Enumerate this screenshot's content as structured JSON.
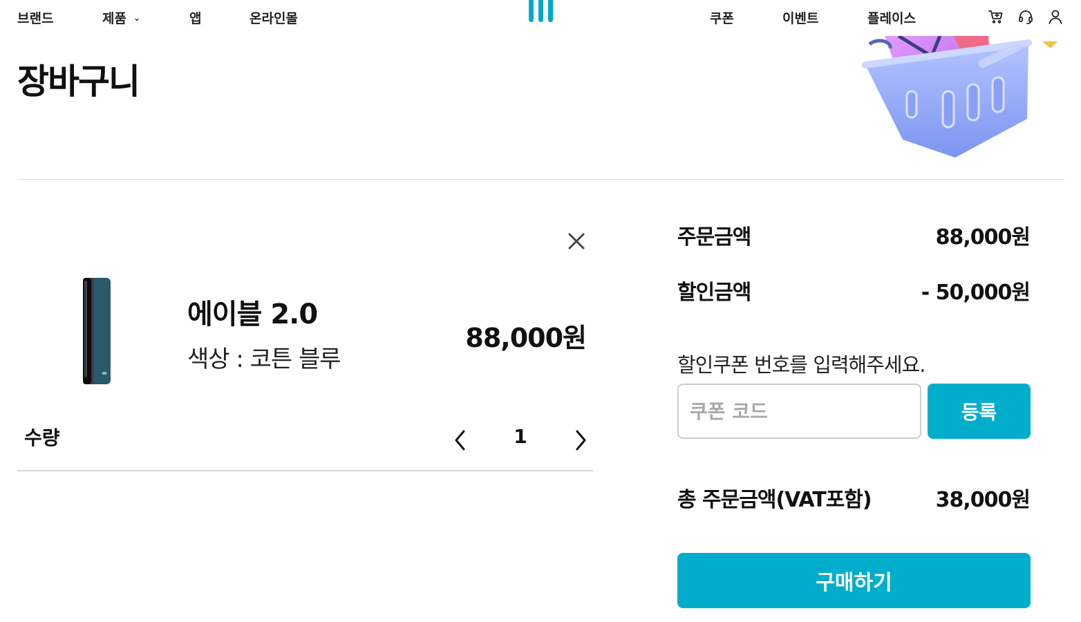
{
  "nav": {
    "left": [
      {
        "label": "브랜드"
      },
      {
        "label": "제품",
        "icon": "chevron-down-icon"
      },
      {
        "label": "앱"
      },
      {
        "label": "온라인몰"
      }
    ],
    "right": [
      {
        "label": "쿠폰"
      },
      {
        "label": "이벤트"
      },
      {
        "label": "플레이스"
      }
    ],
    "icons": [
      "cart-icon",
      "headset-icon",
      "user-icon"
    ],
    "logo_color": "#00a9c6"
  },
  "page": {
    "title": "장바구니"
  },
  "cart": {
    "items": [
      {
        "name": "에이블 2.0",
        "option": "색상 : 코튼 블루",
        "price": "88,000원",
        "quantity_label": "수량",
        "quantity": "1"
      }
    ]
  },
  "summary": {
    "order_amount_label": "주문금액",
    "order_amount": "88,000원",
    "discount_label": "할인금액",
    "discount": "- 50,000원",
    "coupon_prompt": "할인쿠폰 번호를 입력해주세요.",
    "coupon_placeholder": "쿠폰 코드",
    "coupon_value": "",
    "register_label": "등록",
    "total_label": "총 주문금액(VAT포함)",
    "total": "38,000원",
    "buy_label": "구매하기"
  },
  "colors": {
    "accent": "#00aecb",
    "text": "#111111",
    "divider": "#dddddd"
  }
}
